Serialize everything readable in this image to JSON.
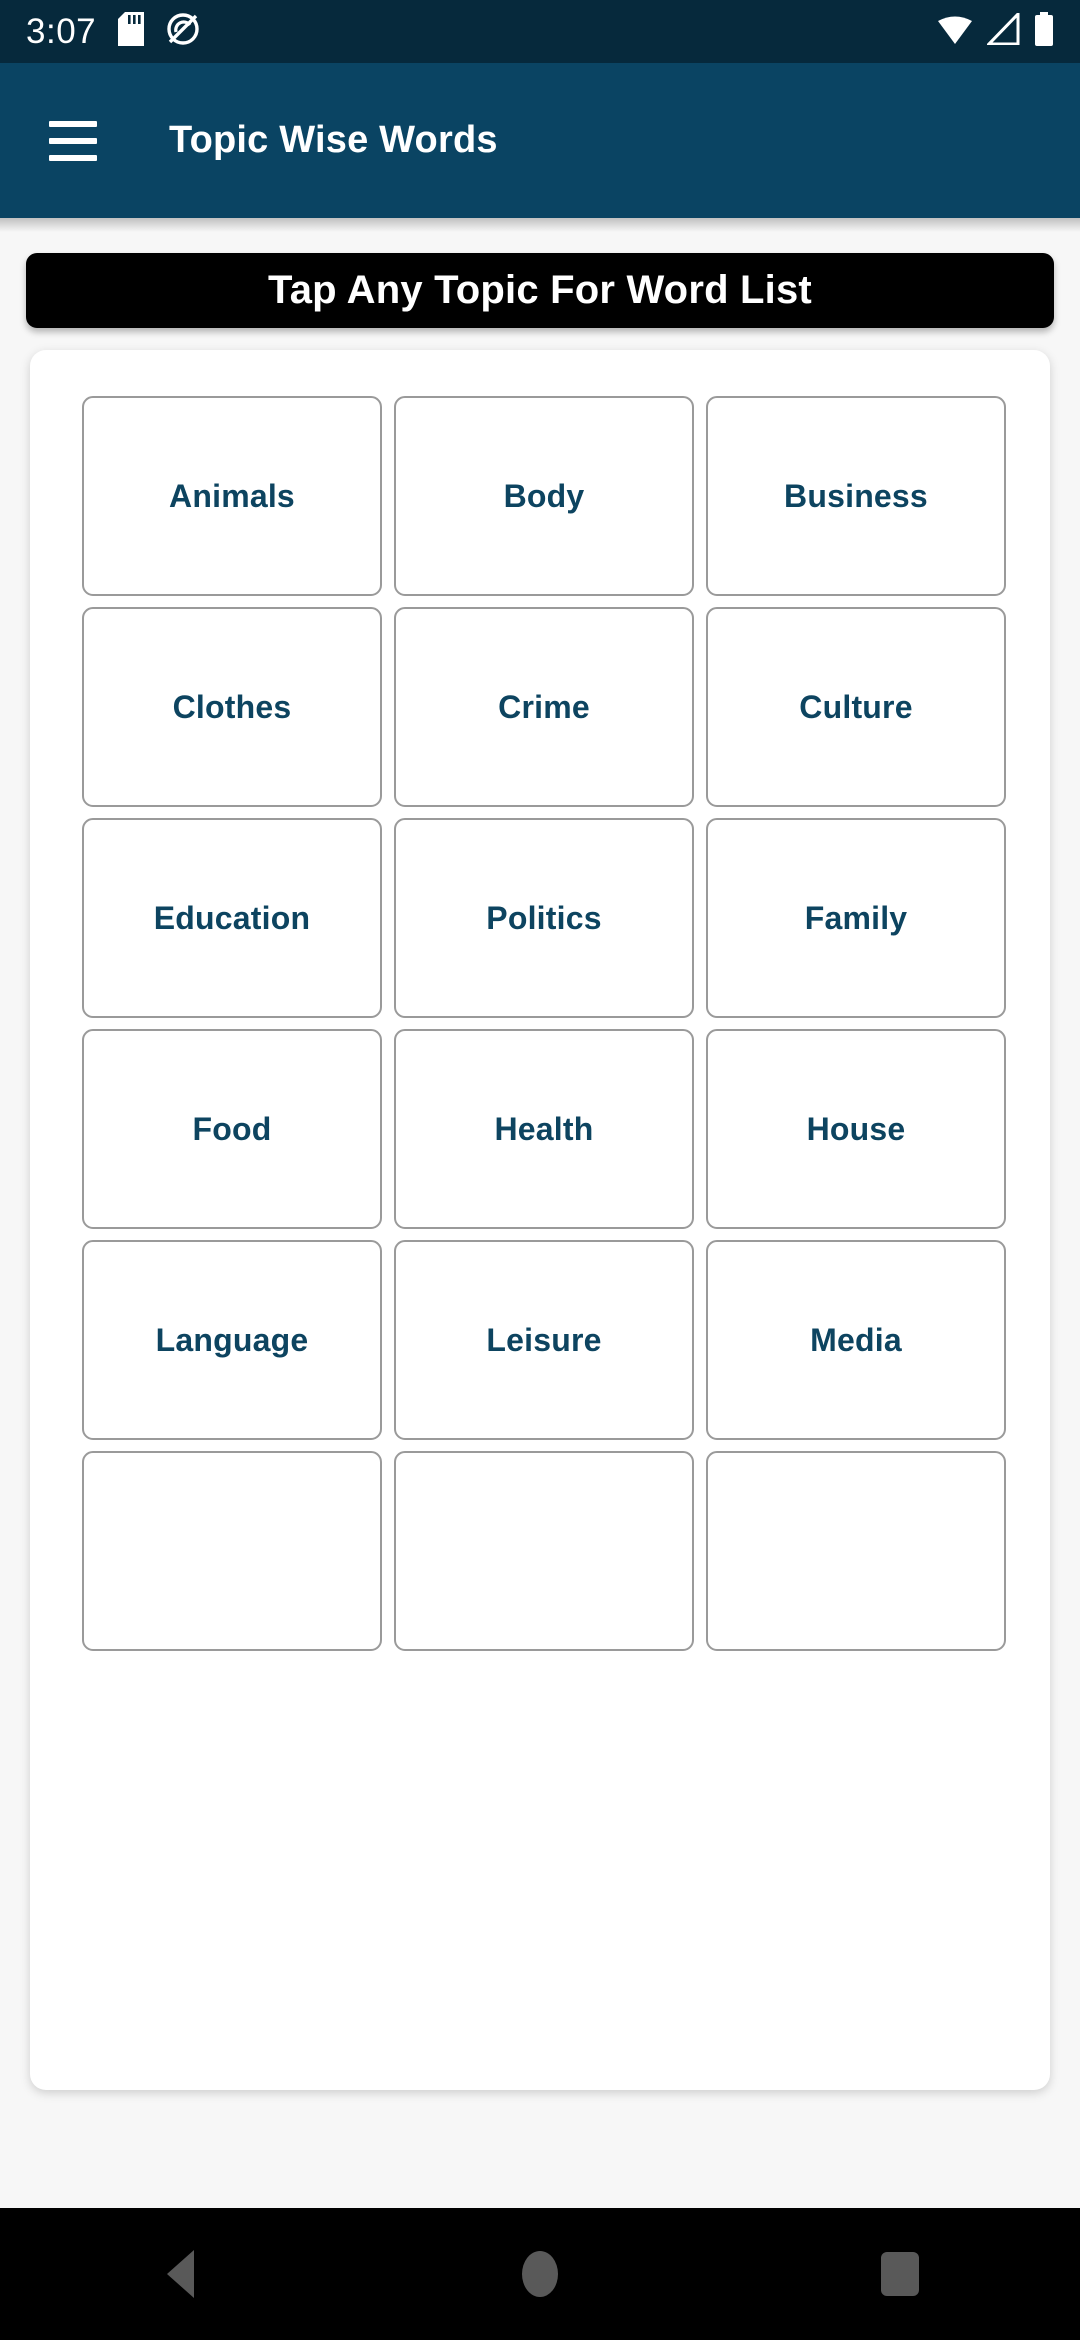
{
  "status_bar": {
    "time": "3:07",
    "icons_left": [
      "sd-card-icon",
      "no-sync-icon"
    ],
    "icons_right": [
      "wifi-icon",
      "cellular-signal-icon",
      "battery-icon"
    ],
    "background_color": "#06293c"
  },
  "app_bar": {
    "menu_icon": "hamburger-menu-icon",
    "title": "Topic Wise Words",
    "background_color": "#0a4463"
  },
  "banner": {
    "text": "Tap Any Topic For Word List",
    "background_color": "#000000",
    "text_color": "#ffffff"
  },
  "topics": {
    "tile_text_color": "#0d4460",
    "items": [
      {
        "label": "Animals"
      },
      {
        "label": "Body"
      },
      {
        "label": "Business"
      },
      {
        "label": "Clothes"
      },
      {
        "label": "Crime"
      },
      {
        "label": "Culture"
      },
      {
        "label": "Education"
      },
      {
        "label": "Politics"
      },
      {
        "label": "Family"
      },
      {
        "label": "Food"
      },
      {
        "label": "Health"
      },
      {
        "label": "House"
      },
      {
        "label": "Language"
      },
      {
        "label": "Leisure"
      },
      {
        "label": "Media"
      },
      {
        "label": ""
      },
      {
        "label": ""
      },
      {
        "label": ""
      }
    ]
  },
  "nav_bar": {
    "background_color": "#000000",
    "buttons": [
      {
        "name": "back-button",
        "icon": "triangle-back-icon"
      },
      {
        "name": "home-button",
        "icon": "circle-home-icon"
      },
      {
        "name": "recents-button",
        "icon": "square-recents-icon"
      }
    ]
  }
}
